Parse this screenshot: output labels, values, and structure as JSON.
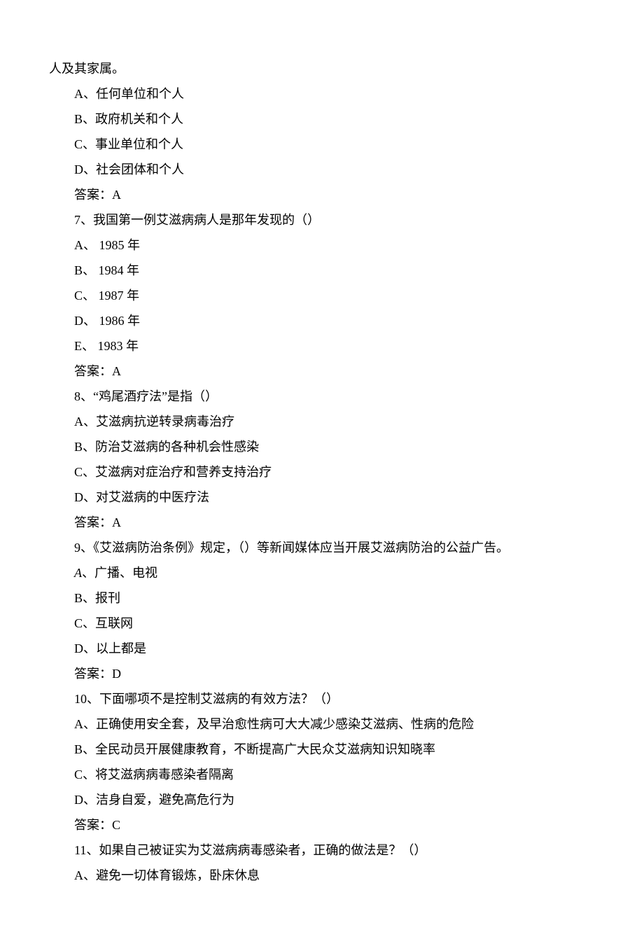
{
  "cont_line": "人及其家属。",
  "q6": {
    "A": "A、任何单位和个人",
    "B": "B、政府机关和个人",
    "C": "C、事业单位和个人",
    "D": "D、社会团体和个人",
    "answer": "答案：A"
  },
  "q7": {
    "stem": "7、我国第一例艾滋病病人是那年发现的（）",
    "A": "A、 1985 年",
    "B": "B、 1984 年",
    "C": "C、 1987 年",
    "D": "D、 1986 年",
    "E": "E、 1983 年",
    "answer": "答案：A"
  },
  "q8": {
    "stem": "8、“鸡尾酒疗法”是指（）",
    "A": "A、艾滋病抗逆转录病毒治疗",
    "B": "B、防治艾滋病的各种机会性感染",
    "C": "C、艾滋病对症治疗和营养支持治疗",
    "D": "D、对艾滋病的中医疗法",
    "answer": "答案：A"
  },
  "q9": {
    "stem": "9、《艾滋病防治条例》规定，（）等新闻媒体应当开展艾滋病防治的公益广告。",
    "A_prefix": "A",
    "A_rest": "、广播、电视",
    "B": "B、报刊",
    "C": "C、互联网",
    "D": "D、以上都是",
    "answer": "答案：D"
  },
  "q10": {
    "stem": "10、下面哪项不是控制艾滋病的有效方法？（）",
    "A": "A、正确使用安全套，及早治愈性病可大大减少感染艾滋病、性病的危险",
    "B": "B、全民动员开展健康教育，不断提高广大民众艾滋病知识知晓率",
    "C": "C、将艾滋病病毒感染者隔离",
    "D": "D、洁身自爱，避免高危行为",
    "answer": "答案：C"
  },
  "q11": {
    "stem": "11、如果自己被证实为艾滋病病毒感染者，正确的做法是？（）",
    "A": "A、避免一切体育锻炼，卧床休息"
  }
}
